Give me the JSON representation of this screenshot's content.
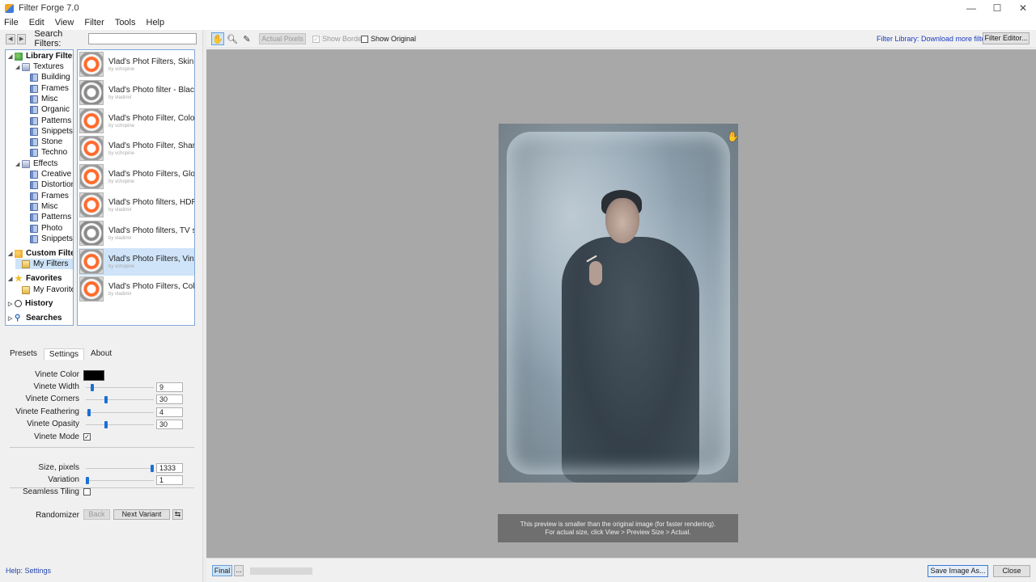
{
  "window": {
    "title": "Filter Forge 7.0",
    "controls": [
      "—",
      "☐",
      "✕"
    ]
  },
  "menu": [
    "File",
    "Edit",
    "View",
    "Filter",
    "Tools",
    "Help"
  ],
  "search": {
    "label": "Search Filters:",
    "value": ""
  },
  "tree": [
    {
      "label": "Library Filters",
      "bold": true,
      "icon": "library-icon"
    },
    {
      "label": "Textures",
      "icon": "folder-icon"
    },
    {
      "label": "Building",
      "icon": "category-icon"
    },
    {
      "label": "Frames",
      "icon": "category-icon"
    },
    {
      "label": "Misc",
      "icon": "category-icon"
    },
    {
      "label": "Organic",
      "icon": "category-icon"
    },
    {
      "label": "Patterns",
      "icon": "category-icon"
    },
    {
      "label": "Snippets",
      "icon": "category-icon"
    },
    {
      "label": "Stone",
      "icon": "category-icon"
    },
    {
      "label": "Techno",
      "icon": "category-icon"
    },
    {
      "label": "Effects",
      "icon": "folder-icon"
    },
    {
      "label": "Creative",
      "icon": "category-icon"
    },
    {
      "label": "Distortions",
      "icon": "category-icon"
    },
    {
      "label": "Frames",
      "icon": "category-icon"
    },
    {
      "label": "Misc",
      "icon": "category-icon"
    },
    {
      "label": "Patterns",
      "icon": "category-icon"
    },
    {
      "label": "Photo",
      "icon": "category-icon"
    },
    {
      "label": "Snippets",
      "icon": "category-icon"
    },
    {
      "label": "Custom Filters",
      "bold": true,
      "icon": "custom-filters-icon"
    },
    {
      "label": "My Filters",
      "selected": true,
      "icon": "my-folder-icon"
    },
    {
      "label": "Favorites",
      "bold": true,
      "icon": "star-icon"
    },
    {
      "label": "My Favorites",
      "icon": "my-folder-icon"
    },
    {
      "label": "History",
      "bold": true,
      "icon": "history-icon"
    },
    {
      "label": "Searches",
      "bold": true,
      "icon": "search-icon"
    }
  ],
  "filters": [
    {
      "title": "Vlad's Phot Filters, Skin tone...",
      "author": "by vchopine"
    },
    {
      "title": "Vlad's Photo filter - Black an...",
      "author": "by vladimir"
    },
    {
      "title": "Vlad's Photo Filter, Color Shi...",
      "author": "by vchopine"
    },
    {
      "title": "Vlad's Photo Filter, Sharpenest",
      "author": "by vchopine"
    },
    {
      "title": "Vlad's Photo Filters, Glow",
      "author": "by vchopine"
    },
    {
      "title": "Vlad's Photo filters, HDR sim...",
      "author": "by vladimir"
    },
    {
      "title": "Vlad's Photo filters, TV shifter",
      "author": "by vladimir"
    },
    {
      "title": "Vlad's Photo Filters, Vinete",
      "author": "by vchopine"
    },
    {
      "title": "Vlad's Photo Filters, Color Ble...",
      "author": "by vladimir"
    }
  ],
  "tabs": [
    "Presets",
    "Settings",
    "About"
  ],
  "settings": {
    "vinete_color_label": "Vinete Color",
    "vinete_color": "#000000",
    "params": [
      {
        "label": "Vinete Width",
        "value": "9",
        "fraction": 0.08
      },
      {
        "label": "Vinete Corners",
        "value": "30",
        "fraction": 0.29
      },
      {
        "label": "Vinete Feathering",
        "value": "4",
        "fraction": 0.03
      },
      {
        "label": "Vinete Opasity",
        "value": "30",
        "fraction": 0.29
      }
    ],
    "vinete_mode_label": "Vinete Mode",
    "vinete_mode_checked": true,
    "size_label": "Size, pixels",
    "size_value": "1333",
    "size_fraction": 1.0,
    "variation_label": "Variation",
    "variation_value": "1",
    "variation_fraction": 0.0,
    "seamless_label": "Seamless Tiling",
    "seamless_checked": false,
    "randomizer_label": "Randomizer",
    "back_label": "Back",
    "next_variant_label": "Next Variant"
  },
  "help_text": "Help: Settings",
  "toolbar": {
    "actual_pixels": "Actual Pixels",
    "show_border": "Show Border",
    "show_original": "Show Original",
    "library_link": "Filter Library: Download more filters",
    "filter_editor": "Filter Editor..."
  },
  "preview_note": {
    "line1": "This preview is smaller than the original image (for faster rendering).",
    "line2": "For actual size, click View > Preview Size > Actual."
  },
  "bottom": {
    "final_label": "Final",
    "dots_label": "...",
    "save_label": "Save Image As...",
    "close_label": "Close"
  }
}
